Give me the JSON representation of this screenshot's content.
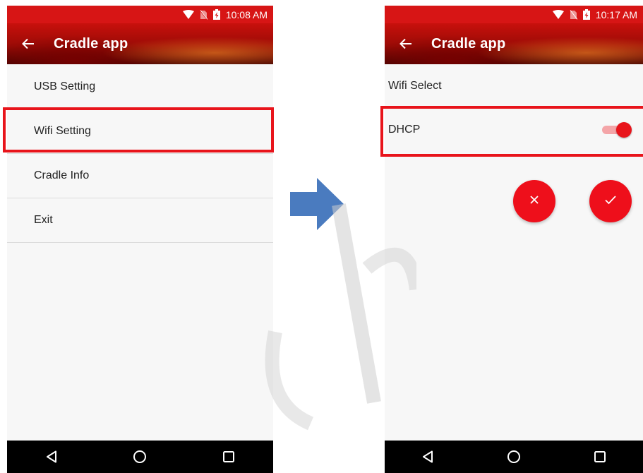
{
  "left_screen": {
    "status_time": "10:08 AM",
    "app_title": "Cradle app",
    "menu_items": [
      {
        "label": "USB Setting"
      },
      {
        "label": "Wifi Setting"
      },
      {
        "label": "Cradle Info"
      },
      {
        "label": "Exit"
      }
    ]
  },
  "right_screen": {
    "status_time": "10:17 AM",
    "app_title": "Cradle app",
    "wifi_select_label": "Wifi Select",
    "dhcp_label": "DHCP",
    "dhcp_enabled": true
  },
  "icons": {
    "status": [
      "wifi-icon",
      "no-sim-icon",
      "battery-charging-icon"
    ],
    "nav": [
      "back-triangle-icon",
      "home-circle-icon",
      "recents-square-icon"
    ],
    "actions": [
      "close-icon",
      "check-icon"
    ]
  },
  "colors": {
    "status_bar": "#d71515",
    "accent": "#e8141b",
    "highlight": "#e8141b",
    "arrow": "#4a7bbf"
  }
}
